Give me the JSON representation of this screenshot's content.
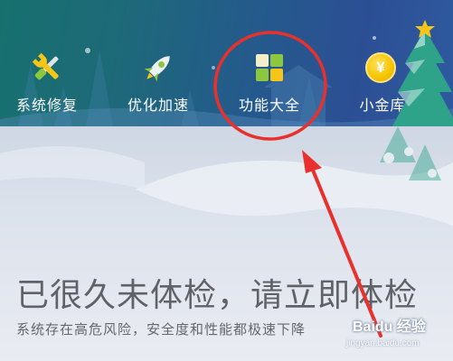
{
  "toolbar": {
    "items": [
      {
        "label": "系统修复",
        "icon": "wrench-screwdriver-icon"
      },
      {
        "label": "优化加速",
        "icon": "rocket-icon"
      },
      {
        "label": "功能大全",
        "icon": "tiles-grid-icon"
      },
      {
        "label": "小金库",
        "icon": "gold-coin-icon",
        "icon_text": "¥"
      }
    ]
  },
  "main": {
    "headline": "已很久未体检，请立即体检",
    "subline": "系统存在高危风险，安全度和性能都极速下降"
  },
  "annotation": {
    "shape": "red-circle-and-arrow",
    "color": "#e8312c"
  },
  "watermark": {
    "logo_text": "Baidu 经验",
    "url": "jingyan.baidu.com"
  },
  "colors": {
    "header_start": "#17706e",
    "header_end": "#2f5aa0",
    "tile_green": "#8dc63f",
    "tile_yellow": "#f5c518",
    "coin": "#f5c400",
    "text_gray": "#5f6369"
  }
}
